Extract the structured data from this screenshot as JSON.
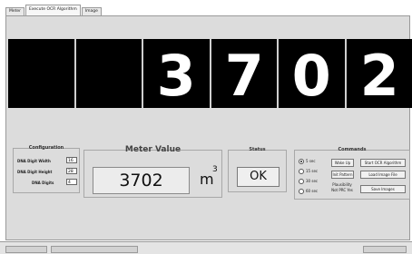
{
  "tabs": [
    {
      "label": "Meter",
      "active": false
    },
    {
      "label": "Execute OCR Algorithm",
      "active": true
    },
    {
      "label": "Image",
      "active": false
    }
  ],
  "digits": [
    "",
    "",
    "3",
    "7",
    "0",
    "2"
  ],
  "configuration": {
    "title": "Configuration",
    "rows": [
      {
        "label": "DNA Digit Width",
        "value": "16"
      },
      {
        "label": "DNA Digit Height",
        "value": "28"
      },
      {
        "label": "DNA Digits",
        "value": "4"
      }
    ]
  },
  "meter": {
    "title": "Meter Value",
    "value": "3702",
    "unit": "m",
    "unit_sup": "3"
  },
  "status": {
    "title": "Status",
    "value": "OK"
  },
  "commands": {
    "title": "Commands",
    "intervals": [
      {
        "label": "5 sec",
        "selected": true
      },
      {
        "label": "15 sec",
        "selected": false
      },
      {
        "label": "30 sec",
        "selected": false
      },
      {
        "label": "60 sec",
        "selected": false
      }
    ],
    "buttons": [
      {
        "label": "Wake Up"
      },
      {
        "label": "Start OCR Algorithm"
      },
      {
        "label": "Init Pattern"
      },
      {
        "label": "Load Image File"
      },
      {
        "label": "Save Images"
      }
    ],
    "plausibility_label": "Plausibility",
    "plausibility_value": "Not PRC Yes"
  }
}
